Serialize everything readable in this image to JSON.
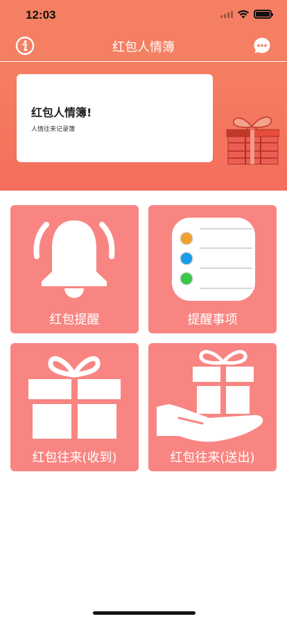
{
  "status_bar": {
    "time": "12:03"
  },
  "nav": {
    "title": "红包人情簿",
    "left_icon": "info-icon",
    "right_icon": "chat-bubble-icon"
  },
  "banner": {
    "title": "红包人情簿!",
    "subtitle": "人情往来记录簿",
    "image": "gift-box-illustration"
  },
  "tiles": [
    {
      "label": "红包提醒",
      "icon": "bell-icon"
    },
    {
      "label": "提醒事项",
      "icon": "reminders-list-icon"
    },
    {
      "label": "红包往来(收到)",
      "icon": "gift-icon"
    },
    {
      "label": "红包往来(送出)",
      "icon": "gift-on-hand-icon"
    }
  ],
  "colors": {
    "header": "#f57f62",
    "tile": "#f88581",
    "white": "#ffffff"
  }
}
